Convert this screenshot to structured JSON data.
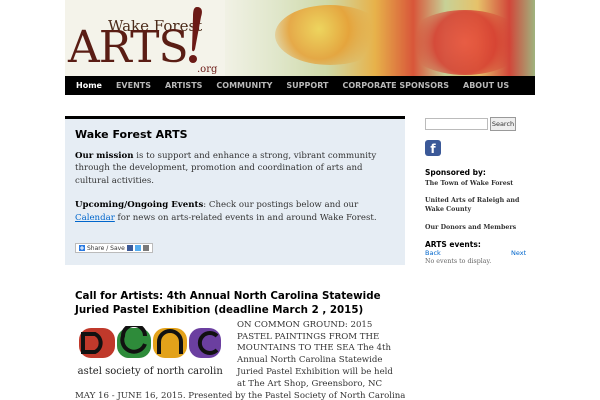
{
  "header": {
    "logo_wake": "Wake Forest",
    "logo_arts": "ARTS",
    "logo_org": ".org"
  },
  "nav": {
    "items": [
      {
        "label": "Home"
      },
      {
        "label": "EVENTS"
      },
      {
        "label": "ARTISTS"
      },
      {
        "label": "COMMUNITY"
      },
      {
        "label": "SUPPORT"
      },
      {
        "label": "CORPORATE SPONSORS"
      },
      {
        "label": "ABOUT US"
      }
    ]
  },
  "intro": {
    "title": "Wake Forest ARTS",
    "mission_label": "Our mission",
    "mission_text": " is to support and enhance a strong, vibrant community through the development, promotion and coordination of arts and cultural activities.",
    "upcoming_label": "Upcoming/Ongoing Events",
    "upcoming_text_before": ": Check our postings below and our ",
    "calendar_link": "Calendar",
    "upcoming_text_after": " for news on arts-related events in and around Wake Forest.",
    "share_label": "Share / Save"
  },
  "post": {
    "title": "Call for Artists: 4th Annual North Carolina Statewide Juried Pastel Exhibition (deadline March 2 , 2015)",
    "image_caption": "pastel society of north carolina",
    "excerpt": "ON COMMON GROUND: 2015 PASTEL PAINTINGS FROM THE MOUNTAINS TO THE SEA The 4th Annual North Carolina Statewide Juried Pastel Exhibition will be held at The Art Shop, Greensboro, NC",
    "excerpt_cont": "MAY 16 - JUNE 16, 2015. Presented by the Pastel Society of North Carolina"
  },
  "sidebar": {
    "search_placeholder": "",
    "search_button": "Search",
    "sponsored_heading": "Sponsored by:",
    "sponsors": [
      "The Town of Wake Forest",
      "United Arts of Raleigh and Wake County",
      "Our Donors and Members"
    ],
    "events_heading": "ARTS events:",
    "back_label": "Back",
    "next_label": "Next",
    "no_events": "No events to display."
  },
  "colors": {
    "nav_bg": "#000000",
    "intro_bg": "#e6edf4",
    "link": "#0066cc",
    "facebook": "#3b5998"
  }
}
